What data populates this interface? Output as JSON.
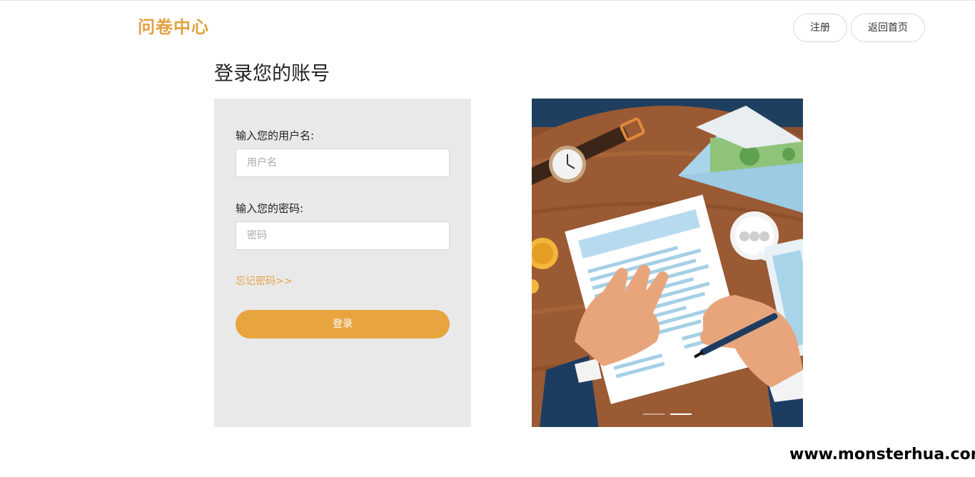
{
  "header": {
    "logo_text": "问卷中心",
    "register_label": "注册",
    "home_label": "返回首页"
  },
  "page": {
    "title": "登录您的账号"
  },
  "form": {
    "username_label": "输入您的用户名:",
    "username_placeholder": "用户名",
    "password_label": "输入您的密码:",
    "password_placeholder": "密码",
    "forgot_label": "忘记密码>>",
    "login_label": "登录"
  },
  "banner": {
    "illustration": "desk-contract-signing",
    "slides": 2,
    "active_slide": 2
  },
  "watermark": "www.monsterhua.com",
  "colors": {
    "accent": "#e8a43f",
    "panel_bg": "#e9e9e9"
  }
}
